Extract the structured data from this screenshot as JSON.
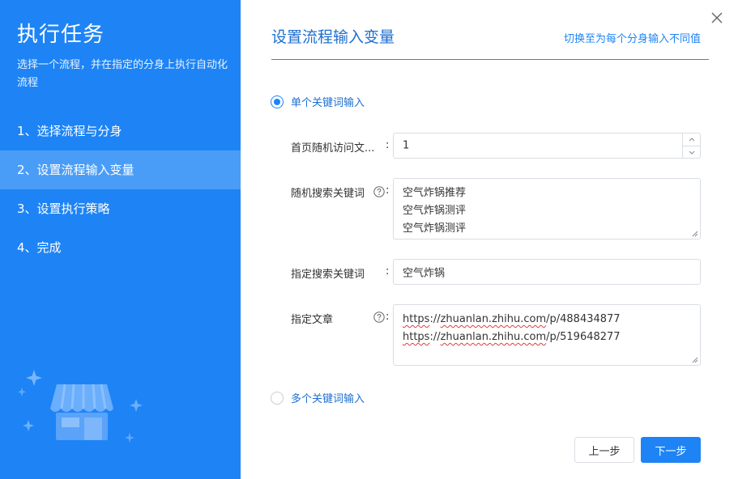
{
  "sidebar": {
    "title": "执行任务",
    "description": "选择一个流程，并在指定的分身上执行自动化流程",
    "steps": [
      {
        "label": "1、选择流程与分身"
      },
      {
        "label": "2、设置流程输入变量"
      },
      {
        "label": "3、设置执行策略"
      },
      {
        "label": "4、完成"
      }
    ],
    "active_step": 1
  },
  "main": {
    "title": "设置流程输入变量",
    "switch_link": "切换至为每个分身输入不同值",
    "single_keyword_option": "单个关键词输入",
    "multi_keyword_option": "多个关键词输入",
    "selected_option": "single",
    "fields": {
      "homepage_visits": {
        "label": "首页随机访问文...",
        "value": "1"
      },
      "random_search_keywords": {
        "label": "随机搜索关键词",
        "lines": [
          "空气炸锅推荐",
          "空气炸锅测评",
          "空气炸锅测评"
        ]
      },
      "specified_search_keyword": {
        "label": "指定搜索关键词",
        "value": "空气炸锅"
      },
      "specified_article": {
        "label": "指定文章",
        "lines": [
          {
            "prefix": "https",
            "sep": "://",
            "domain": "zhuanlan.zhihu.com",
            "path": "/p/488434877"
          },
          {
            "prefix": "https",
            "sep": "://",
            "domain": "zhuanlan.zhihu.com",
            "path": "/p/519648277"
          }
        ]
      }
    },
    "colon": ":"
  },
  "footer": {
    "prev_label": "上一步",
    "next_label": "下一步"
  },
  "colors": {
    "primary": "#1e84f5",
    "sidebar_active": "#4a9df7",
    "title_blue": "#1e6fd0",
    "border": "#d9dde3"
  },
  "icons": {
    "close": "close-icon",
    "help": "question-circle-icon",
    "illustration": "store-icon"
  }
}
